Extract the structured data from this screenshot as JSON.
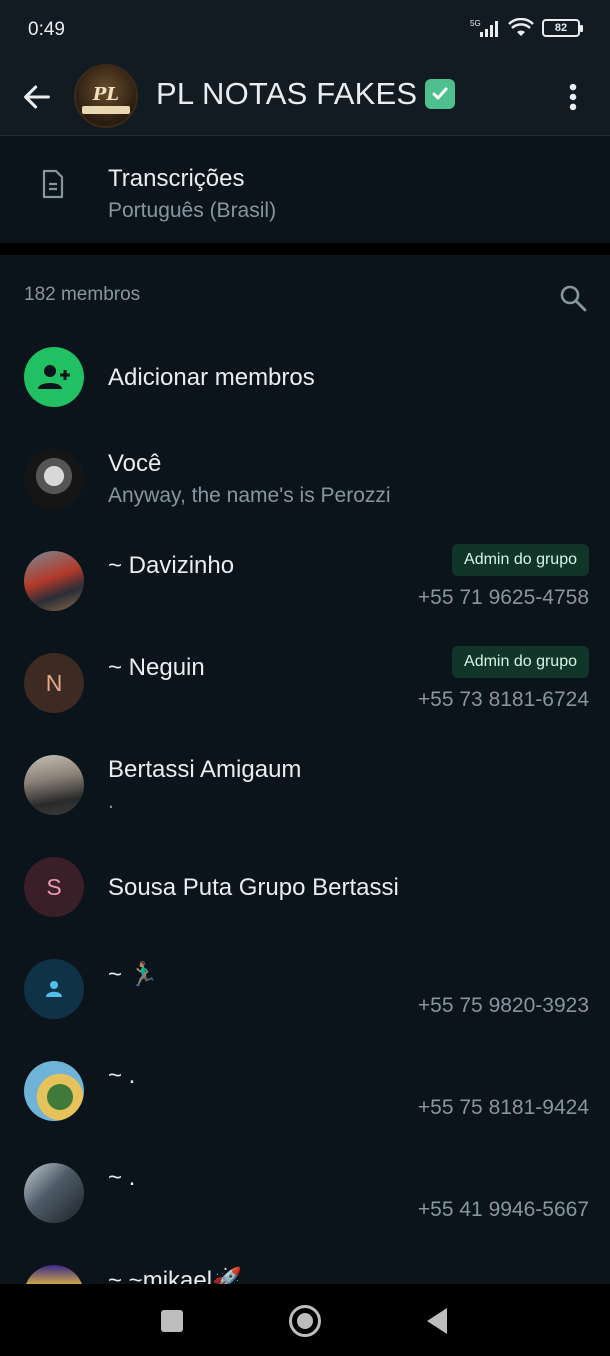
{
  "status_bar": {
    "time": "0:49",
    "network": "5G",
    "battery": "82"
  },
  "header": {
    "back_icon": "arrow-left-icon",
    "group_avatar_text": "PL",
    "title": "PL NOTAS FAKES",
    "verified_icon": "check-badge-icon",
    "menu_icon": "more-vertical-icon"
  },
  "transcriptions": {
    "icon": "document-icon",
    "title": "Transcrições",
    "language": "Português (Brasil)"
  },
  "members": {
    "count_label": "182 membros",
    "search_icon": "search-icon",
    "add_label": "Adicionar membros",
    "list": [
      {
        "name": "Você",
        "status": "Anyway, the name's is Perozzi",
        "badge": "",
        "phone": "",
        "initial": ""
      },
      {
        "name": "~ Davizinho",
        "status": "",
        "badge": "Admin do grupo",
        "phone": "+55 71 9625-4758",
        "initial": ""
      },
      {
        "name": "~ Neguin",
        "status": "",
        "badge": "Admin do grupo",
        "phone": "+55 73 8181-6724",
        "initial": "N"
      },
      {
        "name": "Bertassi Amigaum",
        "status": ".",
        "badge": "",
        "phone": "",
        "initial": ""
      },
      {
        "name": "Sousa Puta Grupo Bertassi",
        "status": "",
        "badge": "",
        "phone": "",
        "initial": "S"
      },
      {
        "name": "~ 🏃🏽‍♂️",
        "status": "",
        "badge": "",
        "phone": "+55 75 9820-3923",
        "initial": ""
      },
      {
        "name": "~ .",
        "status": "",
        "badge": "",
        "phone": "+55 75 8181-9424",
        "initial": ""
      },
      {
        "name": "~ .",
        "status": "",
        "badge": "",
        "phone": "+55 41 9946-5667",
        "initial": ""
      },
      {
        "name": "~ ~mikael🚀",
        "status": "",
        "badge": "",
        "phone": "",
        "initial": ""
      }
    ]
  },
  "colors": {
    "background": "#0b141a",
    "accent_green": "#21c063",
    "badge_bg": "#103529",
    "secondary_text": "#8696a0"
  },
  "nav_bar": {
    "recents_icon": "square-icon",
    "home_icon": "circle-icon",
    "back_icon": "triangle-back-icon"
  }
}
